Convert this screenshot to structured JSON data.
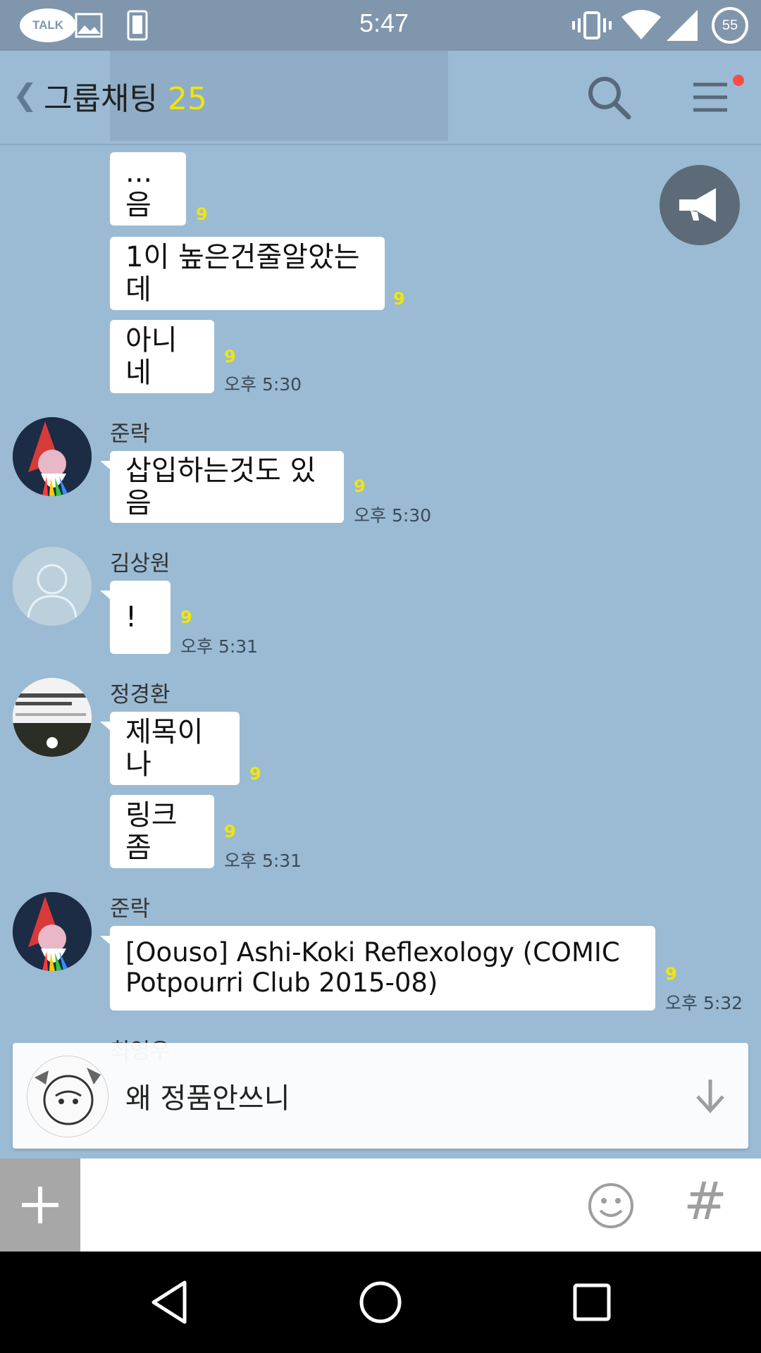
{
  "status_bar": {
    "time": "5:47",
    "battery": "55",
    "talk_label": "TALK",
    "icons": [
      "talk-notification-icon",
      "image-notification-icon",
      "phone-notification-icon",
      "vibrate-icon",
      "wifi-icon",
      "cell-signal-icon",
      "battery-icon"
    ]
  },
  "header": {
    "title": "그룹채팅",
    "member_count": "25",
    "icons": [
      "back-chevron-icon",
      "search-icon",
      "menu-icon"
    ]
  },
  "messages": [
    {
      "text": "...음",
      "unread": "9",
      "time": ""
    },
    {
      "text": "1이 높은건줄알았는데",
      "unread": "9",
      "time": ""
    },
    {
      "text": "아니네",
      "unread": "9",
      "time": "오후 5:30"
    },
    {
      "sender": "준락",
      "text": "삽입하는것도 있음",
      "unread": "9",
      "time": "오후 5:30"
    },
    {
      "sender": "김상원",
      "text": "!",
      "unread": "9",
      "time": "오후 5:31"
    },
    {
      "sender": "정경환",
      "text": "제목이나",
      "unread": "9",
      "time": ""
    },
    {
      "text": "링크좀",
      "unread": "9",
      "time": "오후 5:31"
    },
    {
      "sender": "준락",
      "text": "[Oouso] Ashi-Koki Reflexology (COMIC Potpourri Club 2015-08)",
      "unread": "9",
      "time": "오후 5:32"
    },
    {
      "sender": "최영우",
      "text": "",
      "unread": "",
      "time": ""
    }
  ],
  "preview": {
    "text": "왜 정품안쓰니"
  },
  "input_bar": {
    "hash_label": "#",
    "icons": [
      "plus-icon",
      "emoticon-icon",
      "hash-icon"
    ]
  },
  "nav_bar": {
    "icons": [
      "back-triangle-icon",
      "home-circle-icon",
      "recents-square-icon"
    ]
  },
  "colors": {
    "chat_background": "#9bbbd4",
    "status_bar": "#7f96ad",
    "unread_yellow": "#f2e600",
    "bubble": "#ffffff"
  }
}
